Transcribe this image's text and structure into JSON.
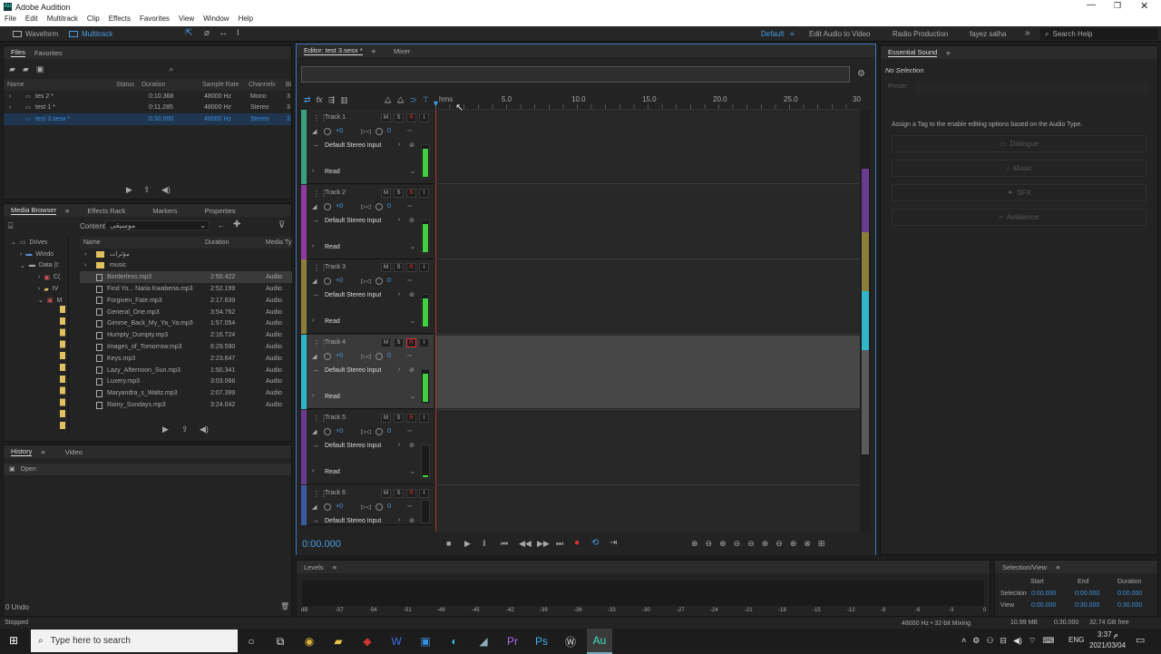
{
  "title": "Adobe Audition",
  "menu": [
    "File",
    "Edit",
    "Multitrack",
    "Clip",
    "Effects",
    "Favorites",
    "View",
    "Window",
    "Help"
  ],
  "toolbar": {
    "waveform": "Waveform",
    "multitrack": "Multitrack",
    "workspaces": [
      "Default",
      "Edit Audio to Video",
      "Radio Production",
      "fayez salha"
    ],
    "search_placeholder": "Search Help"
  },
  "files": {
    "tabs": [
      "Files",
      "Favorites"
    ],
    "headers": [
      "Name",
      "Status",
      "Duration",
      "Sample Rate",
      "Channels",
      "Bi"
    ],
    "rows": [
      {
        "name": "tes 2 *",
        "duration": "0:10.368",
        "rate": "48000 Hz",
        "channels": "Mono",
        "bits": "3"
      },
      {
        "name": "test 1 *",
        "duration": "0:11.285",
        "rate": "48000 Hz",
        "channels": "Stereo",
        "bits": "3"
      },
      {
        "name": "test 3.sesx *",
        "duration": "0:30.000",
        "rate": "48000 Hz",
        "channels": "Stereo",
        "bits": "3"
      }
    ]
  },
  "media": {
    "tabs": [
      "Media Browser",
      "Effects Rack",
      "Markers",
      "Properties"
    ],
    "contents_label": "Contents:",
    "contents_value": "موسيقى",
    "tree": [
      "Drives",
      "Windo",
      "Data (I:",
      "C(",
      "IV",
      "M"
    ],
    "headers": [
      "Name",
      "Duration",
      "Media Ty"
    ],
    "folders": [
      "مؤثرات",
      "music"
    ],
    "files": [
      {
        "name": "Borderless.mp3",
        "duration": "2:50.422",
        "type": "Audio"
      },
      {
        "name": "Find Yo... Naria Kwabena.mp3",
        "duration": "2:52.199",
        "type": "Audio"
      },
      {
        "name": "Forgiven_Fate.mp3",
        "duration": "2:17.639",
        "type": "Audio"
      },
      {
        "name": "General_One.mp3",
        "duration": "3:54.762",
        "type": "Audio"
      },
      {
        "name": "Gimme_Back_My_Ya_Ya.mp3",
        "duration": "1:57.054",
        "type": "Audio"
      },
      {
        "name": "Humpty_Dumpty.mp3",
        "duration": "2:16.724",
        "type": "Audio"
      },
      {
        "name": "Images_of_Tomorrow.mp3",
        "duration": "6:29.590",
        "type": "Audio"
      },
      {
        "name": "Keys.mp3",
        "duration": "2:23.647",
        "type": "Audio"
      },
      {
        "name": "Lazy_Afternoon_Sun.mp3",
        "duration": "1:50.341",
        "type": "Audio"
      },
      {
        "name": "Luxery.mp3",
        "duration": "3:03.066",
        "type": "Audio"
      },
      {
        "name": "Maryandra_s_Waltz.mp3",
        "duration": "2:07.399",
        "type": "Audio"
      },
      {
        "name": "Rainy_Sundays.mp3",
        "duration": "3:24.042",
        "type": "Audio"
      }
    ]
  },
  "history": {
    "tabs": [
      "History",
      "Video"
    ],
    "items": [
      "Open"
    ],
    "undo": "0 Undo"
  },
  "editor": {
    "tabs": [
      "Editor: test 3.sesx *",
      "Mixer"
    ],
    "ruler": [
      "hms",
      "5.0",
      "10.0",
      "15.0",
      "20.0",
      "25.0",
      "30"
    ],
    "time": "0:00.000",
    "tracks": [
      {
        "name": "Track 1",
        "vol": "+0",
        "pan": "0",
        "input": "Default Stereo Input",
        "mode": "Read",
        "color": "#3aa17a",
        "level": 0.9
      },
      {
        "name": "Track 2",
        "vol": "+0",
        "pan": "0",
        "input": "Default Stereo Input",
        "mode": "Read",
        "color": "#8e3aa0",
        "level": 0.9
      },
      {
        "name": "Track 3",
        "vol": "+0",
        "pan": "0",
        "input": "Default Stereo Input",
        "mode": "Read",
        "color": "#8a7e3a",
        "level": 0.9
      },
      {
        "name": "Track 4",
        "vol": "+0",
        "pan": "0",
        "input": "Default Stereo Input",
        "mode": "Read",
        "color": "#2fb6c7",
        "level": 0.9
      },
      {
        "name": "Track 5",
        "vol": "+0",
        "pan": "0",
        "input": "Default Stereo Input",
        "mode": "Read",
        "color": "#6a3a8e",
        "level": 0.05
      },
      {
        "name": "Track 6",
        "vol": "+0",
        "pan": "0",
        "input": "Default Stereo Input",
        "mode": "Read",
        "color": "#3a5a9e",
        "level": 0
      }
    ]
  },
  "essential": {
    "title": "Essential Sound",
    "no_selection": "No Selection",
    "preset": "Preset:",
    "hint": "Assign a Tag to the enable editing options based on the Audio Type.",
    "types": [
      "Dialogue",
      "Music",
      "SFX",
      "Ambience"
    ]
  },
  "levels": {
    "title": "Levels",
    "scale": [
      "dB",
      "-57",
      "-54",
      "-51",
      "-48",
      "-45",
      "-42",
      "-39",
      "-36",
      "-33",
      "-30",
      "-27",
      "-24",
      "-21",
      "-18",
      "-15",
      "-12",
      "-9",
      "-6",
      "-3",
      "0"
    ]
  },
  "selview": {
    "title": "Selection/View",
    "headers": [
      "Start",
      "End",
      "Duration"
    ],
    "selection": [
      "Selection",
      "0:00.000",
      "0:00.000",
      "0:00.000"
    ],
    "view": [
      "View",
      "0:00.000",
      "0:30.000",
      "0:30.000"
    ]
  },
  "status": {
    "left": "Stopped",
    "format": "48000 Hz • 32-bit Mixing",
    "mem": "10.99 MB",
    "dur": "0:30.000",
    "free": "32.74 GB free"
  },
  "taskbar": {
    "search": "Type here to search",
    "lang": "ENG",
    "time": "3:37 م",
    "date": "2021/03/04"
  }
}
